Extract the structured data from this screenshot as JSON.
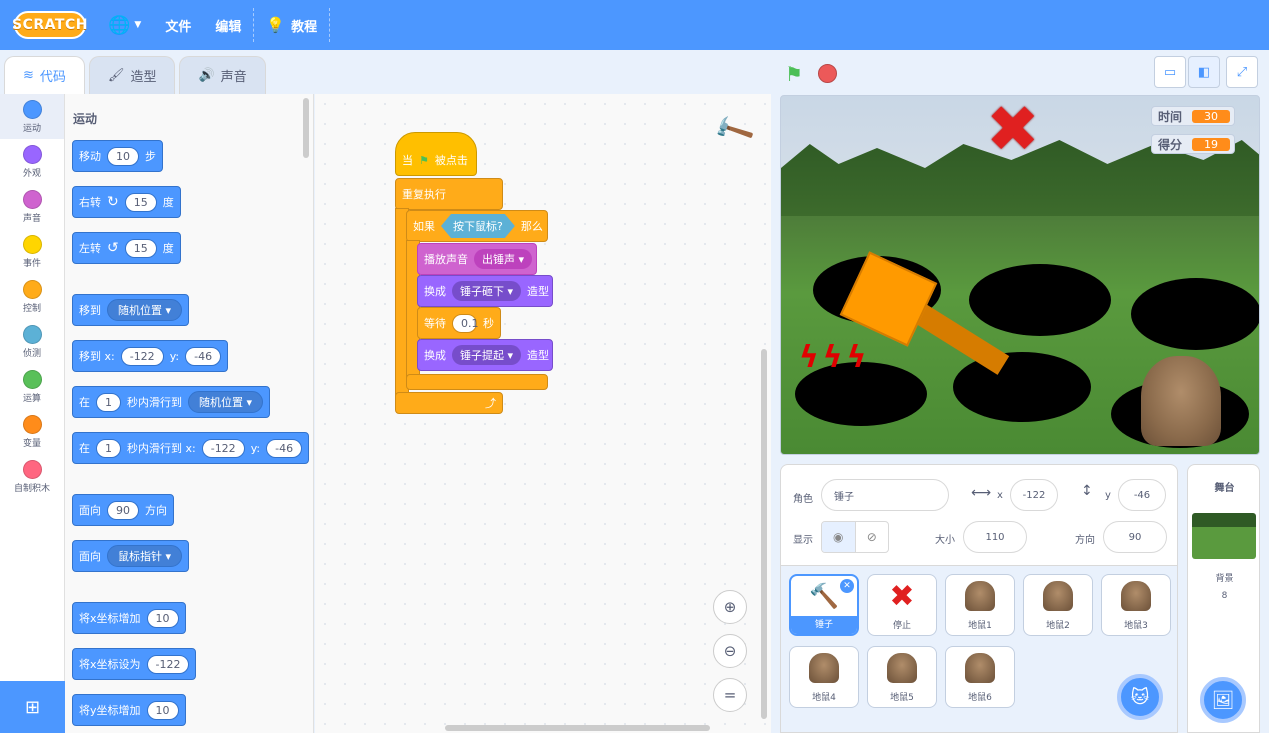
{
  "menubar": {
    "logo": "SCRATCH",
    "file": "文件",
    "edit": "编辑",
    "tutorials": "教程"
  },
  "tabs": [
    {
      "label": "代码",
      "icon": "code-icon"
    },
    {
      "label": "造型",
      "icon": "brush-icon"
    },
    {
      "label": "声音",
      "icon": "speaker-icon"
    }
  ],
  "categories": [
    {
      "label": "运动",
      "color": "#4c97ff"
    },
    {
      "label": "外观",
      "color": "#9966ff"
    },
    {
      "label": "声音",
      "color": "#cf63cf"
    },
    {
      "label": "事件",
      "color": "#ffd500"
    },
    {
      "label": "控制",
      "color": "#ffab19"
    },
    {
      "label": "侦测",
      "color": "#5cb1d6"
    },
    {
      "label": "运算",
      "color": "#59c059"
    },
    {
      "label": "变量",
      "color": "#ff8c1a"
    },
    {
      "label": "自制积木",
      "color": "#ff6680"
    }
  ],
  "palette": {
    "title": "运动",
    "move": {
      "label": "移动",
      "value": "10",
      "unit": "步"
    },
    "turn_right": {
      "label": "右转",
      "value": "15",
      "unit": "度"
    },
    "turn_left": {
      "label": "左转",
      "value": "15",
      "unit": "度"
    },
    "goto": {
      "label": "移到",
      "option": "随机位置"
    },
    "goto_xy": {
      "label": "移到 x:",
      "x": "-122",
      "ylabel": "y:",
      "y": "-46"
    },
    "glide": {
      "label": "在",
      "secs": "1",
      "mid": "秒内滑行到",
      "option": "随机位置"
    },
    "glide_xy": {
      "label": "在",
      "secs": "1",
      "mid": "秒内滑行到 x:",
      "x": "-122",
      "ylabel": "y:",
      "y": "-46"
    },
    "point_dir": {
      "label": "面向",
      "value": "90",
      "unit": "方向"
    },
    "point_towards": {
      "label": "面向",
      "option": "鼠标指针"
    },
    "change_x": {
      "label": "将x坐标增加",
      "value": "10"
    },
    "set_x": {
      "label": "将x坐标设为",
      "value": "-122"
    },
    "change_y": {
      "label": "将y坐标增加",
      "value": "10"
    }
  },
  "script": {
    "hat": {
      "pre": "当",
      "post": "被点击"
    },
    "forever": "重复执行",
    "if": {
      "label": "如果",
      "cond": "按下鼠标?",
      "then": "那么"
    },
    "play_sound": {
      "label": "播放声音",
      "option": "出锤声"
    },
    "switch1": {
      "label": "换成",
      "option": "锤子砸下",
      "post": "造型"
    },
    "wait": {
      "label": "等待",
      "value": "0.1",
      "unit": "秒"
    },
    "switch2": {
      "label": "换成",
      "option": "锤子提起",
      "post": "造型"
    }
  },
  "stage": {
    "timer_label": "时间",
    "timer_value": "30",
    "score_label": "得分",
    "score_value": "19"
  },
  "sprite_info": {
    "sprite_label": "角色",
    "sprite_name": "锤子",
    "x_label": "x",
    "x": "-122",
    "y_label": "y",
    "y": "-46",
    "show_label": "显示",
    "size_label": "大小",
    "size": "110",
    "dir_label": "方向",
    "direction": "90"
  },
  "sprites": [
    {
      "name": "锤子",
      "icon": "hammer-icon"
    },
    {
      "name": "停止",
      "icon": "x-icon"
    },
    {
      "name": "地鼠1",
      "icon": "squirrel-icon"
    },
    {
      "name": "地鼠2",
      "icon": "squirrel-icon"
    },
    {
      "name": "地鼠3",
      "icon": "squirrel-icon"
    },
    {
      "name": "地鼠4",
      "icon": "squirrel-icon"
    },
    {
      "name": "地鼠5",
      "icon": "squirrel-icon"
    },
    {
      "name": "地鼠6",
      "icon": "squirrel-icon"
    }
  ],
  "stage_panel": {
    "title": "舞台",
    "backdrop_label": "背景",
    "backdrop_count": "8"
  }
}
